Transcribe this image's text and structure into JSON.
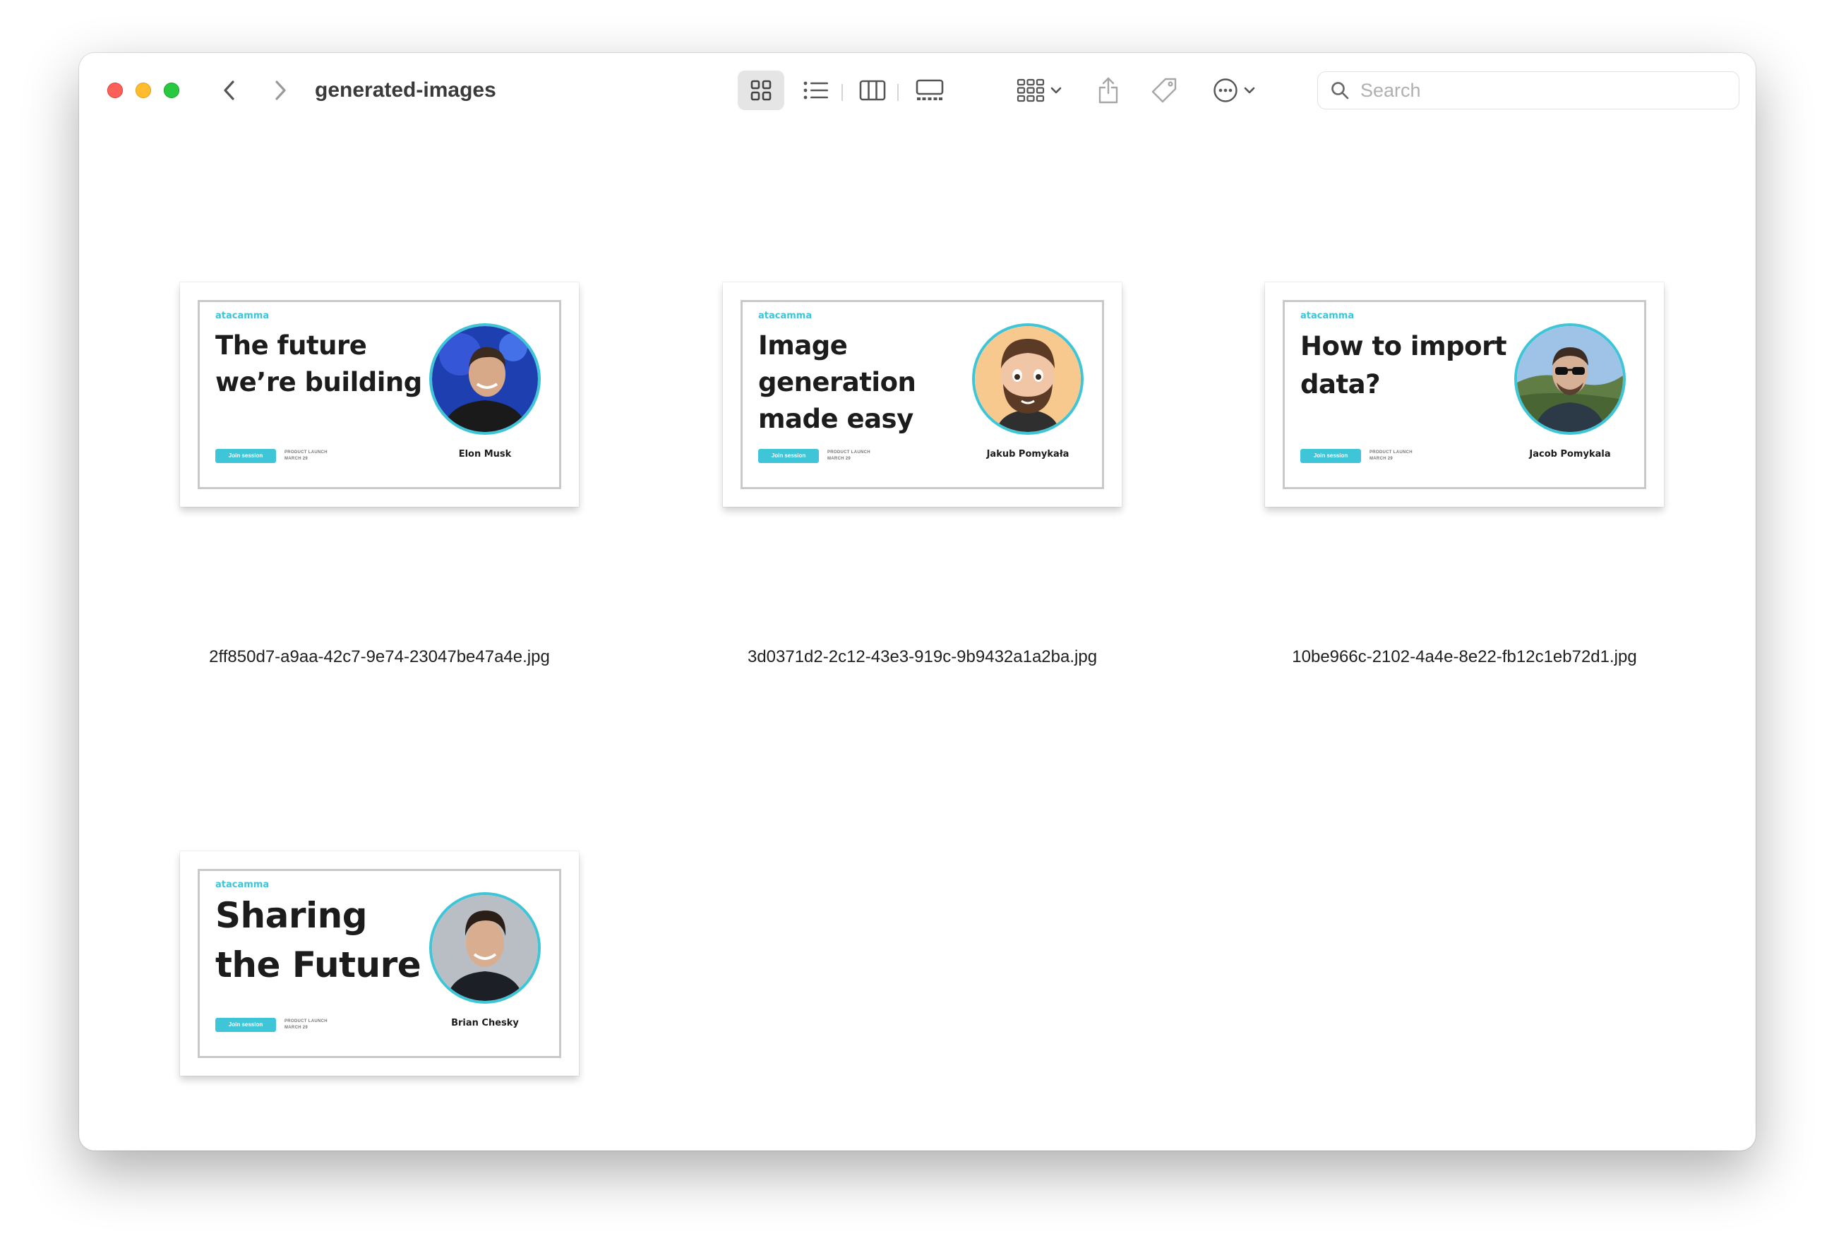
{
  "window": {
    "title": "generated-images",
    "search_placeholder": "Search"
  },
  "toolbar": {
    "icons": [
      "back-icon",
      "forward-icon",
      "icon-view-icon",
      "list-view-icon",
      "column-view-icon",
      "gallery-view-icon",
      "group-icon",
      "share-icon",
      "tag-icon",
      "more-actions-icon",
      "search-icon"
    ]
  },
  "colors": {
    "accent": "#3ec5d8",
    "close": "#fe5f57",
    "minimize": "#febc2e",
    "zoom": "#28c840"
  },
  "files": [
    {
      "filename": "2ff850d7-a9aa-42c7-9e74-23047be47a4e.jpg",
      "card": {
        "brand": "atacamma",
        "headline": "The future we’re building",
        "button": "Join session",
        "meta_line1": "PRODUCT LAUNCH",
        "meta_line2": "MARCH 29",
        "person": "Elon Musk"
      }
    },
    {
      "filename": "3d0371d2-2c12-43e3-919c-9b9432a1a2ba.jpg",
      "card": {
        "brand": "atacamma",
        "headline": "Image generation made easy",
        "button": "Join session",
        "meta_line1": "PRODUCT LAUNCH",
        "meta_line2": "MARCH 29",
        "person": "Jakub Pomykała"
      }
    },
    {
      "filename": "10be966c-2102-4a4e-8e22-fb12c1eb72d1.jpg",
      "card": {
        "brand": "atacamma",
        "headline": "How to import data?",
        "button": "Join session",
        "meta_line1": "PRODUCT LAUNCH",
        "meta_line2": "MARCH 29",
        "person": "Jacob Pomykala"
      }
    },
    {
      "filename": "",
      "card": {
        "brand": "atacamma",
        "headline": "Sharing the Future",
        "button": "Join session",
        "meta_line1": "PRODUCT LAUNCH",
        "meta_line2": "MARCH 29",
        "person": "Brian Chesky"
      }
    }
  ]
}
